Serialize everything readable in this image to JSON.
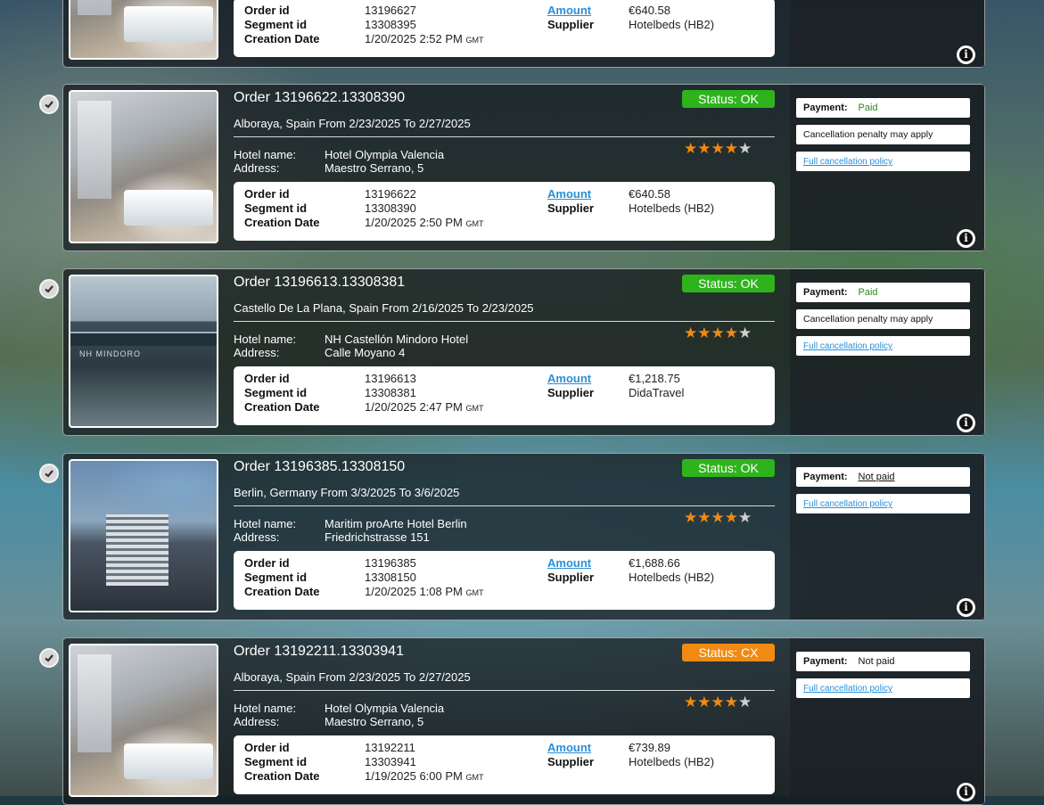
{
  "labels": {
    "order_id": "Order id",
    "segment_id": "Segment id",
    "creation_date": "Creation Date",
    "amount": "Amount",
    "supplier": "Supplier",
    "hotel_name": "Hotel name:",
    "address": "Address:",
    "payment": "Payment:",
    "cancellation_penalty": "Cancellation penalty may apply",
    "full_cancellation_policy": "Full cancellation policy",
    "gmt": "GMT"
  },
  "colors": {
    "status_ok": "#2fb31c",
    "status_cx": "#f08a12",
    "star_on": "#f08a12",
    "star_off": "#cfcfcf",
    "link": "#2a8fd8",
    "paid": "#2b8a1d"
  },
  "icons": {
    "check": "check-circle-icon",
    "info": "info-icon",
    "star": "star-icon"
  },
  "orders": [
    {
      "order_id": "13196627",
      "segment_id": "13308395",
      "creation": "1/20/2025 2:52 PM",
      "amount": "€640.58",
      "supplier": "Hotelbeds (HB2)"
    },
    {
      "title": "Order 13196622.13308390",
      "status": "Status: OK",
      "route": "Alboraya, Spain From 2/23/2025 To 2/27/2025",
      "hotel_name": "Hotel Olympia Valencia",
      "address": "Maestro Serrano, 5",
      "rating": 4,
      "order_id": "13196622",
      "segment_id": "13308390",
      "creation": "1/20/2025 2:50 PM",
      "amount": "€640.58",
      "supplier": "Hotelbeds (HB2)",
      "payment": "Paid"
    },
    {
      "title": "Order 13196613.13308381",
      "status": "Status: OK",
      "route": "Castello De La Plana, Spain From 2/16/2025 To 2/23/2025",
      "hotel_name": "NH Castellón Mindoro Hotel",
      "address": "Calle Moyano 4",
      "rating": 4,
      "order_id": "13196613",
      "segment_id": "13308381",
      "creation": "1/20/2025 2:47 PM",
      "amount": "€1,218.75",
      "supplier": "DidaTravel",
      "payment": "Paid",
      "thumb_caption": "NH MINDORO"
    },
    {
      "title": "Order 13196385.13308150",
      "status": "Status: OK",
      "route": "Berlin, Germany From 3/3/2025 To 3/6/2025",
      "hotel_name": "Maritim proArte Hotel Berlin",
      "address": "Friedrichstrasse 151",
      "rating": 4,
      "order_id": "13196385",
      "segment_id": "13308150",
      "creation": "1/20/2025 1:08 PM",
      "amount": "€1,688.66",
      "supplier": "Hotelbeds (HB2)",
      "payment": "Not paid"
    },
    {
      "title": "Order 13192211.13303941",
      "status": "Status: CX",
      "route": "Alboraya, Spain From 2/23/2025 To 2/27/2025",
      "hotel_name": "Hotel Olympia Valencia",
      "address": "Maestro Serrano, 5",
      "rating": 4,
      "order_id": "13192211",
      "segment_id": "13303941",
      "creation": "1/19/2025 6:00 PM",
      "amount": "€739.89",
      "supplier": "Hotelbeds (HB2)",
      "payment": "Not paid"
    }
  ]
}
